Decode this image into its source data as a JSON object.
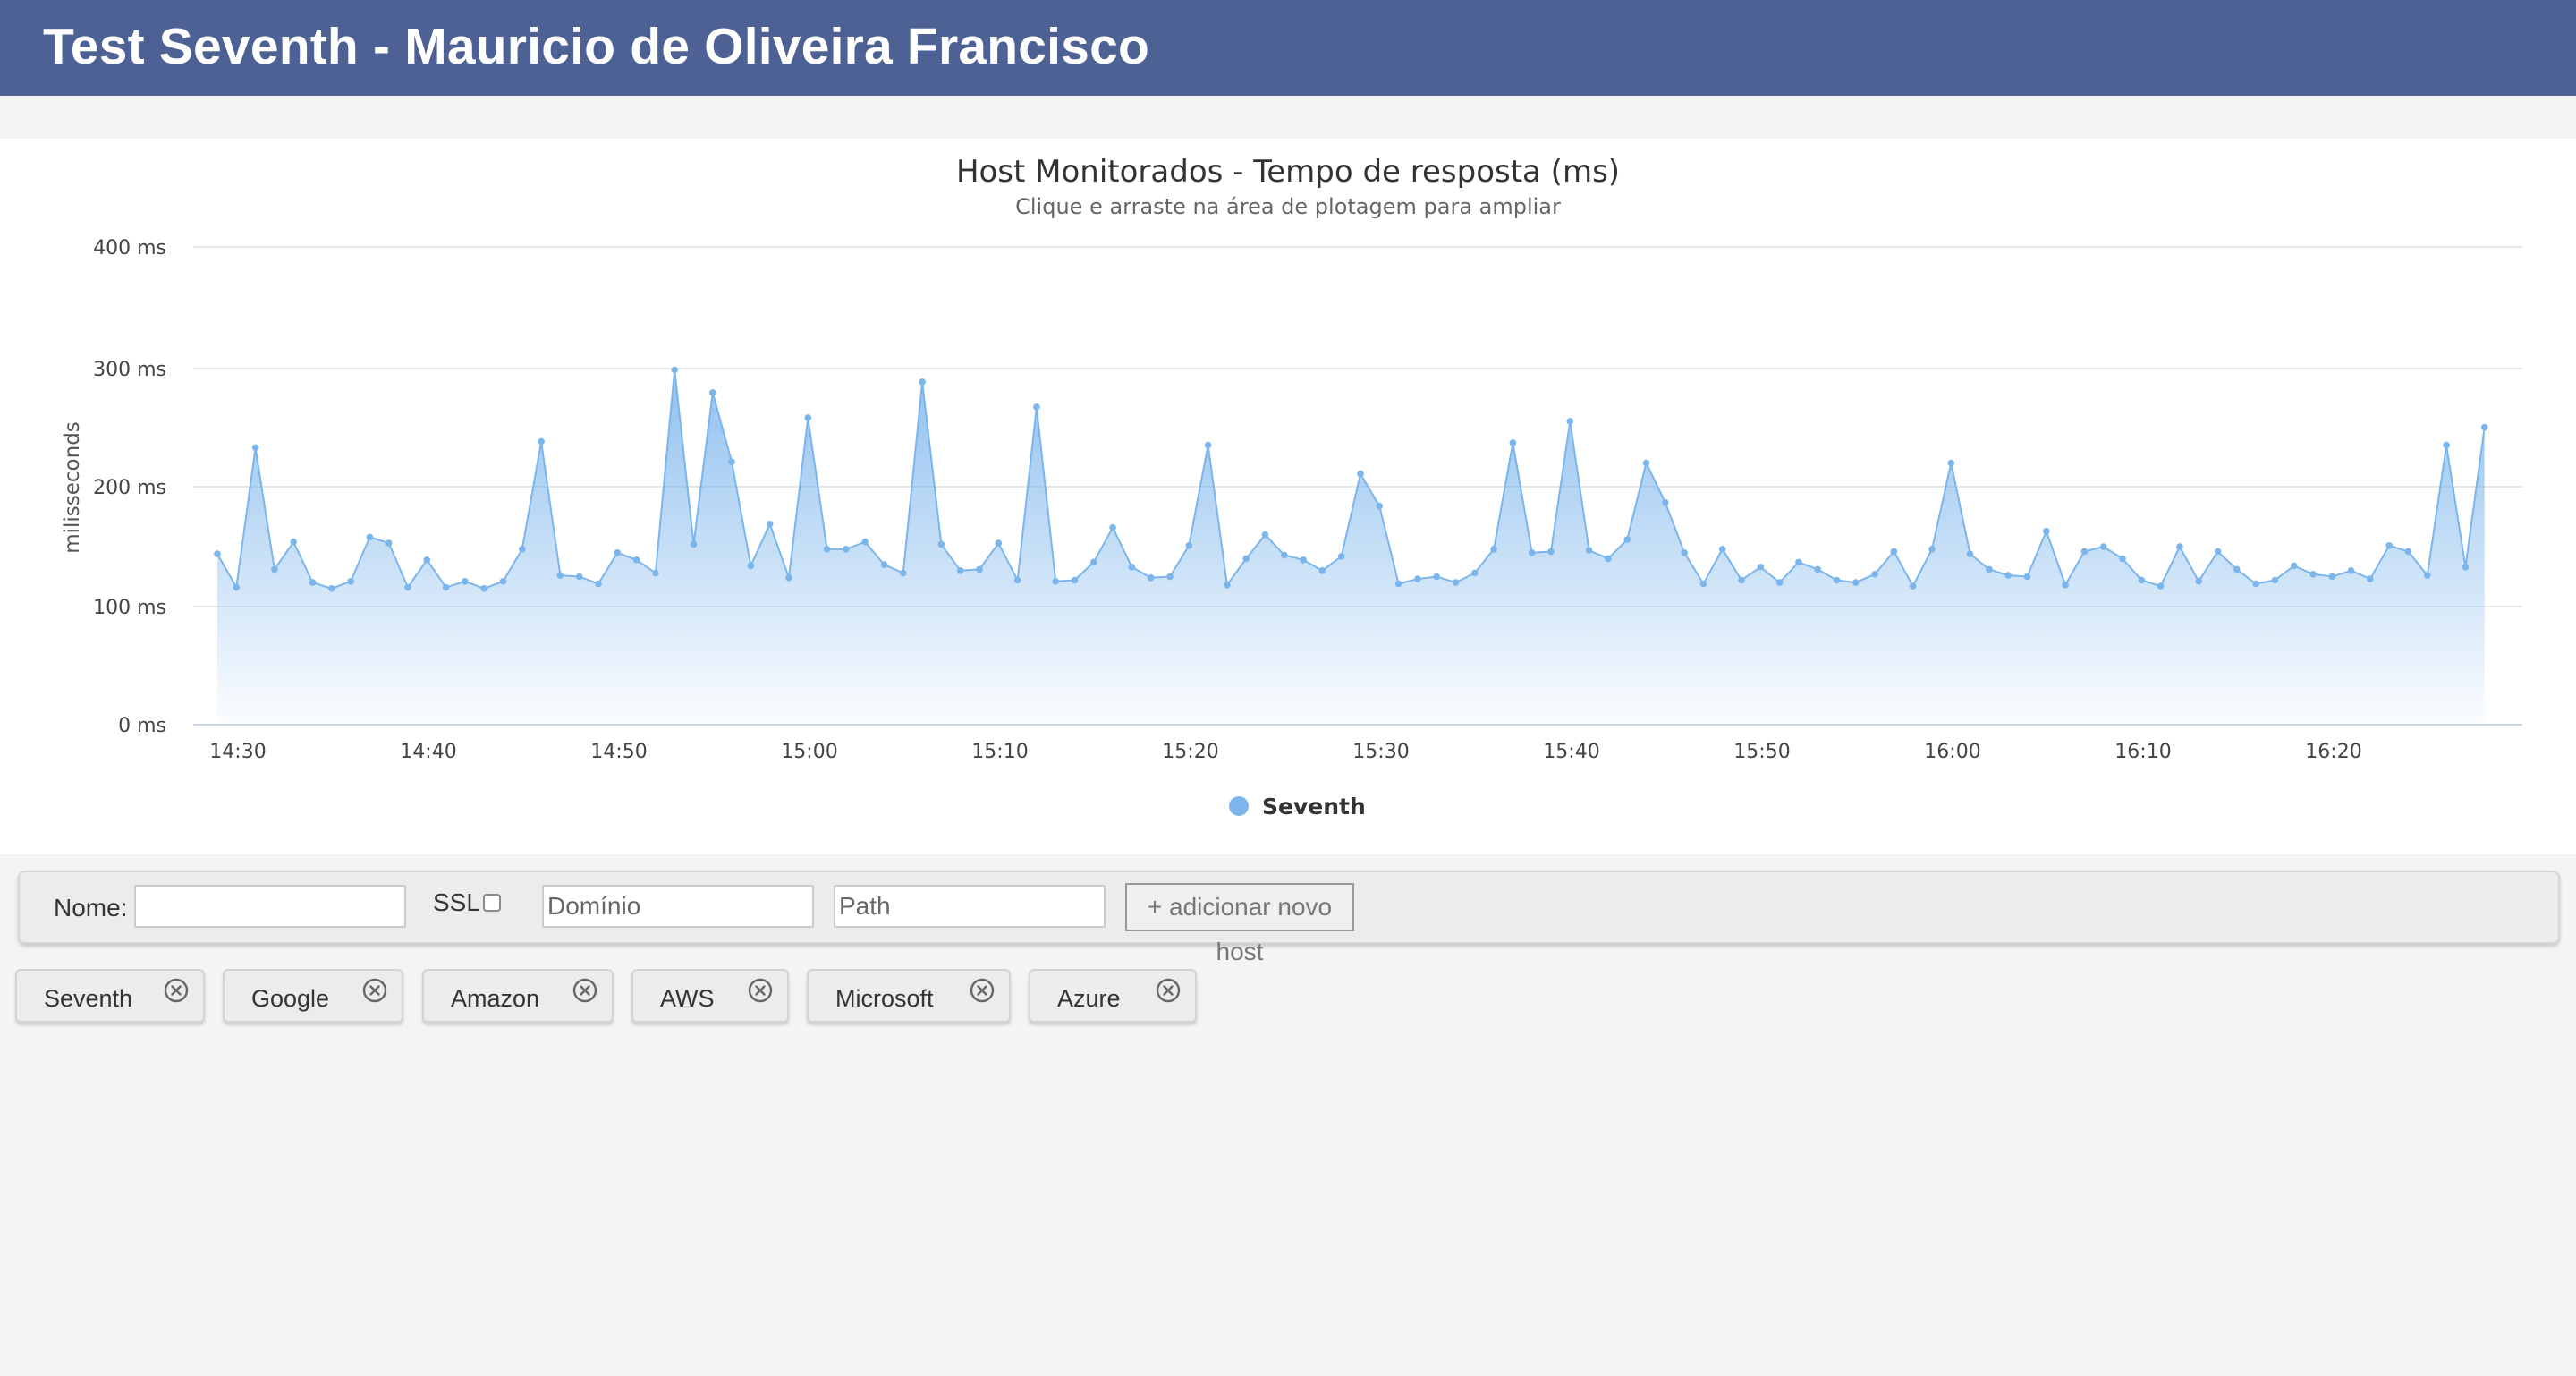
{
  "header": {
    "title": "Test Seventh - Mauricio de Oliveira Francisco"
  },
  "chart": {
    "title": "Host Monitorados - Tempo de resposta (ms)",
    "subtitle": "Clique e arraste na área de plotagem para ampliar",
    "y_axis_title": "milisseconds",
    "y_tick_labels": [
      "0 ms",
      "100 ms",
      "200 ms",
      "300 ms",
      "400 ms"
    ],
    "x_tick_labels": [
      "14:30",
      "14:40",
      "14:50",
      "15:00",
      "15:10",
      "15:20",
      "15:30",
      "15:40",
      "15:50",
      "16:00",
      "16:10",
      "16:20"
    ],
    "legend_label": "Seventh"
  },
  "chart_data": {
    "type": "area",
    "title": "Host Monitorados - Tempo de resposta (ms)",
    "subtitle": "Clique e arraste na área de plotagem para ampliar",
    "ylabel": "milisseconds",
    "ylim": [
      0,
      400
    ],
    "x_unit": "time of day",
    "x_start": "14:28:55",
    "x_step_minutes": 1,
    "grid": true,
    "legend_position": "bottom-center",
    "color": "#7cb5ec",
    "series": [
      {
        "name": "Seventh",
        "values": [
          143,
          115,
          232,
          130,
          153,
          119,
          114,
          120,
          157,
          152,
          115,
          138,
          115,
          120,
          114,
          120,
          147,
          237,
          125,
          124,
          118,
          144,
          138,
          127,
          297,
          151,
          278,
          220,
          133,
          168,
          123,
          257,
          147,
          147,
          153,
          134,
          127,
          287,
          151,
          129,
          130,
          152,
          121,
          266,
          120,
          121,
          136,
          165,
          132,
          123,
          124,
          150,
          234,
          117,
          139,
          159,
          142,
          138,
          129,
          141,
          210,
          183,
          118,
          122,
          124,
          119,
          127,
          147,
          236,
          144,
          145,
          254,
          146,
          139,
          155,
          219,
          186,
          144,
          118,
          147,
          121,
          132,
          119,
          136,
          130,
          121,
          119,
          126,
          145,
          116,
          147,
          219,
          143,
          130,
          125,
          124,
          162,
          117,
          145,
          149,
          139,
          121,
          116,
          149,
          120,
          145,
          130,
          118,
          121,
          133,
          126,
          124,
          129,
          122,
          150,
          145,
          125,
          234,
          132,
          249
        ]
      }
    ]
  },
  "form": {
    "name_label": "Nome:",
    "name_value": "",
    "ssl_label": "SSL",
    "domain_placeholder": "Domínio",
    "path_placeholder": "Path",
    "add_button_label": "+ adicionar novo host"
  },
  "hosts": [
    {
      "label": "Seventh"
    },
    {
      "label": "Google"
    },
    {
      "label": "Amazon"
    },
    {
      "label": "AWS"
    },
    {
      "label": "Microsoft"
    },
    {
      "label": "Azure"
    }
  ],
  "colors": {
    "header_bg": "#4d6194",
    "series": "#7cb5ec",
    "page_bg": "#f4f4f4"
  }
}
